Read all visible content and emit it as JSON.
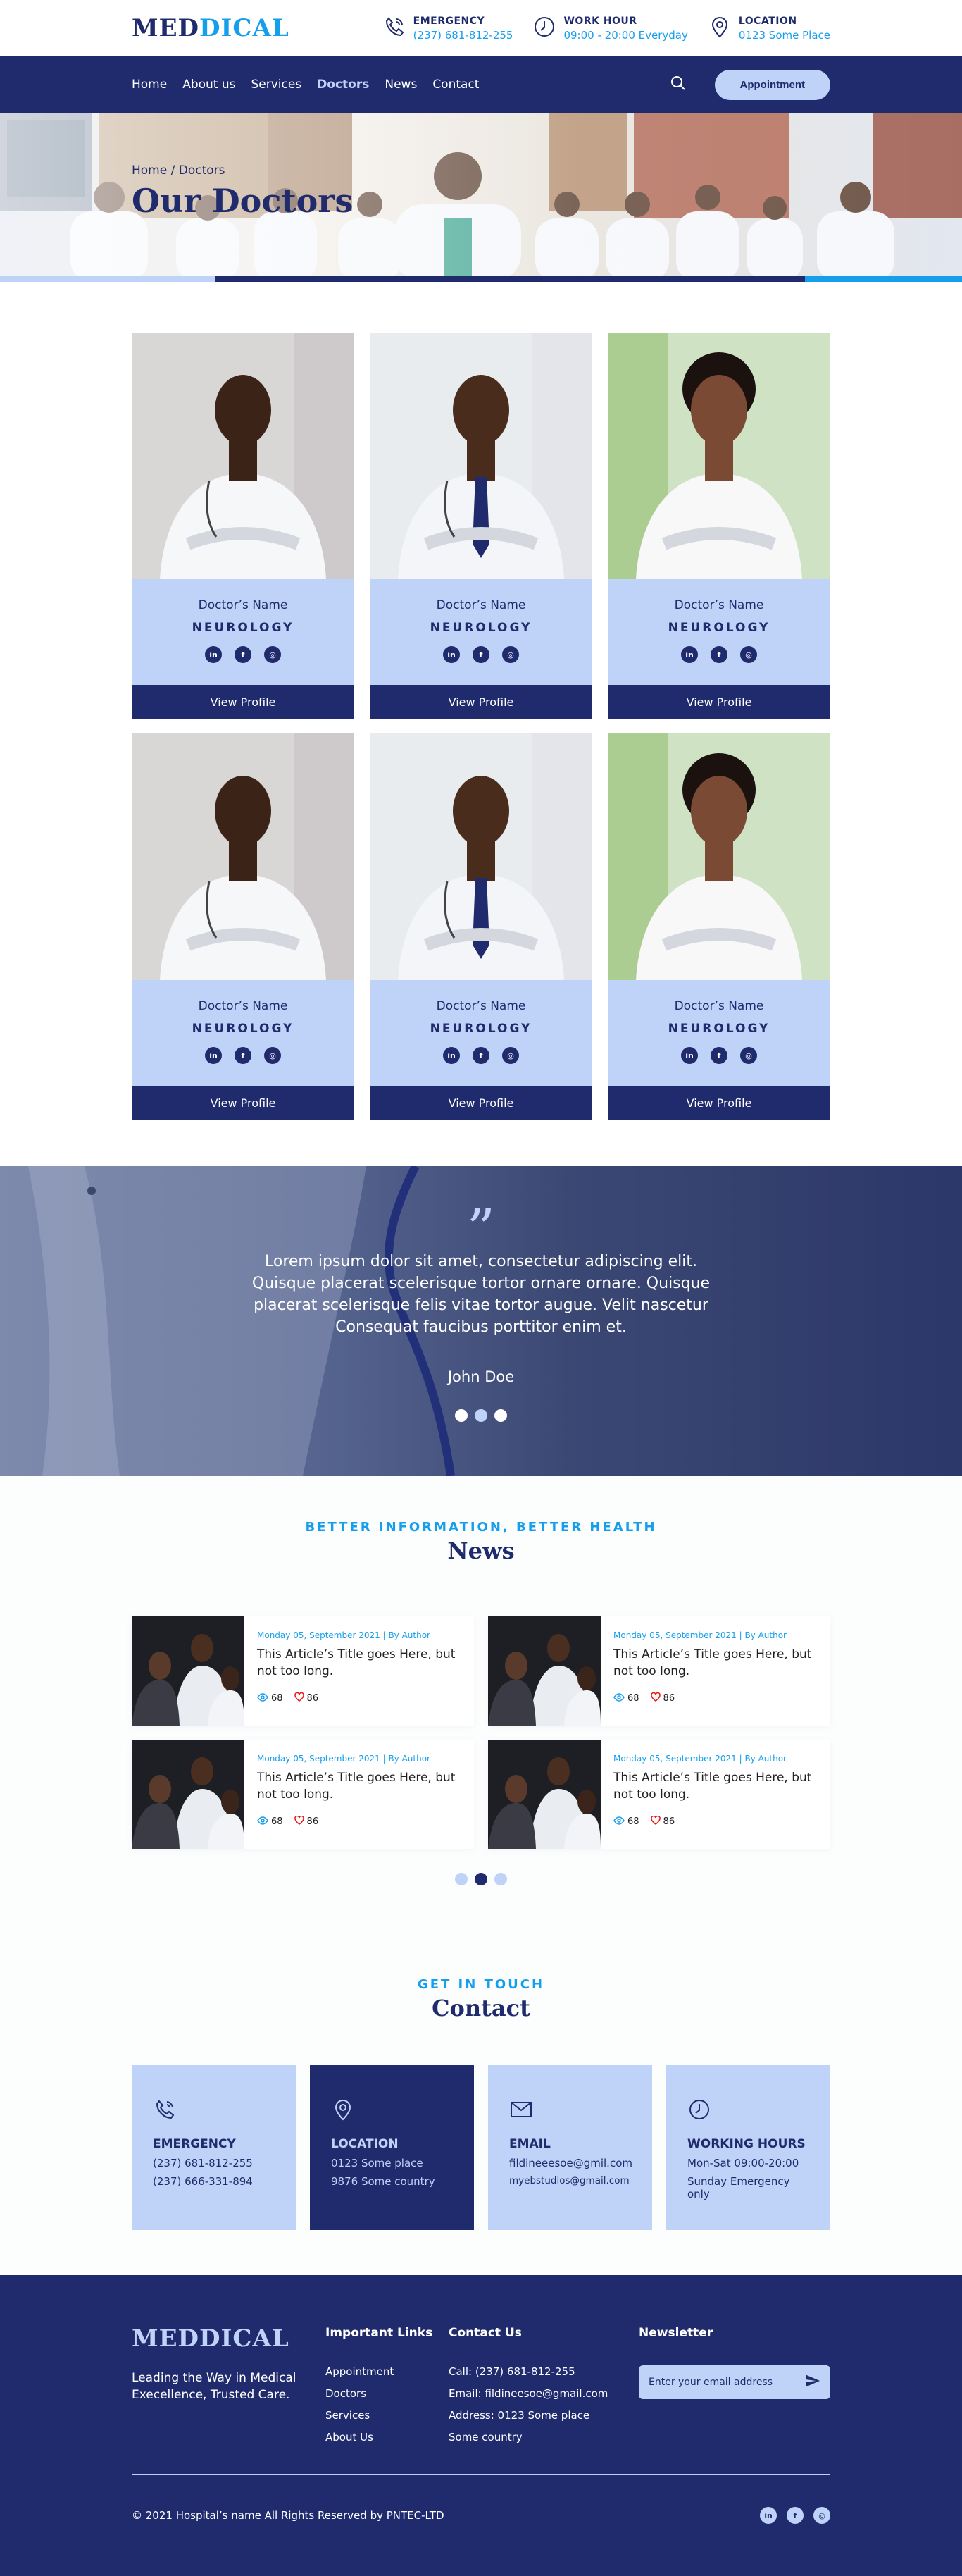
{
  "brand": {
    "part1": "MED",
    "part2": "DICAL",
    "colors": {
      "primary": "#1F2B6C",
      "accent": "#159EEC",
      "light": "#BFD2F8"
    }
  },
  "topbar": {
    "items": [
      {
        "icon": "phone-icon",
        "title": "EMERGENCY",
        "value": "(237) 681-812-255"
      },
      {
        "icon": "clock-icon",
        "title": "WORK HOUR",
        "value": "09:00 - 20:00 Everyday"
      },
      {
        "icon": "location-pin-icon",
        "title": "LOCATION",
        "value": "0123 Some Place"
      }
    ]
  },
  "nav": {
    "links": [
      "Home",
      "About us",
      "Services",
      "Doctors",
      "News",
      "Contact"
    ],
    "active": "Doctors",
    "appointment_label": "Appointment"
  },
  "hero": {
    "breadcrumb": "Home / Doctors",
    "title": "Our Doctors"
  },
  "doctors": {
    "cards": [
      {
        "name": "Doctor’s Name",
        "specialty": "NEUROLOGY",
        "button": "View Profile"
      },
      {
        "name": "Doctor’s Name",
        "specialty": "NEUROLOGY",
        "button": "View Profile"
      },
      {
        "name": "Doctor’s Name",
        "specialty": "NEUROLOGY",
        "button": "View Profile"
      },
      {
        "name": "Doctor’s Name",
        "specialty": "NEUROLOGY",
        "button": "View Profile"
      },
      {
        "name": "Doctor’s Name",
        "specialty": "NEUROLOGY",
        "button": "View Profile"
      },
      {
        "name": "Doctor’s Name",
        "specialty": "NEUROLOGY",
        "button": "View Profile"
      }
    ],
    "social_icons": [
      "linkedin-icon",
      "facebook-icon",
      "instagram-icon"
    ]
  },
  "testimonial": {
    "quote_mark": "”",
    "text": "Lorem ipsum dolor sit amet, consectetur adipiscing elit. Quisque placerat scelerisque tortor ornare ornare. Quisque placerat scelerisque felis vitae tortor augue. Velit nascetur Consequat faucibus porttitor enim et.",
    "author": "John Doe"
  },
  "news": {
    "eyebrow": "Better information, Better health",
    "title": "News",
    "articles": [
      {
        "meta": "Monday 05, September 2021 | By Author",
        "title": "This Article’s Title goes Here, but not too long.",
        "views": "68",
        "likes": "86"
      },
      {
        "meta": "Monday 05, September 2021 | By Author",
        "title": "This Article’s Title goes Here, but not too long.",
        "views": "68",
        "likes": "86"
      },
      {
        "meta": "Monday 05, September 2021 | By Author",
        "title": "This Article’s Title goes Here, but not too long.",
        "views": "68",
        "likes": "86"
      },
      {
        "meta": "Monday 05, September 2021 | By Author",
        "title": "This Article’s Title goes Here, but not too long.",
        "views": "68",
        "likes": "86"
      }
    ]
  },
  "contact": {
    "eyebrow": "Get in touch",
    "title": "Contact",
    "cards": [
      {
        "icon": "phone-icon",
        "title": "EMERGENCY",
        "lines": [
          "(237) 681-812-255",
          "(237) 666-331-894"
        ]
      },
      {
        "icon": "location-pin-icon",
        "title": "LOCATION",
        "lines": [
          "0123 Some place",
          "9876 Some country"
        ]
      },
      {
        "icon": "mail-icon",
        "title": "EMAIL",
        "lines": [
          "fildineeesoe@gmil.com",
          "myebstudios@gmail.com"
        ]
      },
      {
        "icon": "clock-icon",
        "title": "WORKING HOURS",
        "lines": [
          "Mon-Sat 09:00-20:00",
          "Sunday Emergency only"
        ]
      }
    ]
  },
  "footer": {
    "logo": "MEDDICAL",
    "tagline": "Leading the Way in Medical Execellence, Trusted Care.",
    "links_title": "Important Links",
    "links": [
      "Appointment",
      "Doctors",
      "Services",
      "About Us"
    ],
    "contact_title": "Contact Us",
    "contact_lines": [
      "Call: (237) 681-812-255",
      "Email: fildineesoe@gmail.com",
      "Address: 0123 Some place",
      "Some country"
    ],
    "newsletter_title": "Newsletter",
    "newsletter_placeholder": "Enter your email address",
    "copyright": "© 2021 Hospital’s name All Rights Reserved by PNTEC-LTD"
  }
}
